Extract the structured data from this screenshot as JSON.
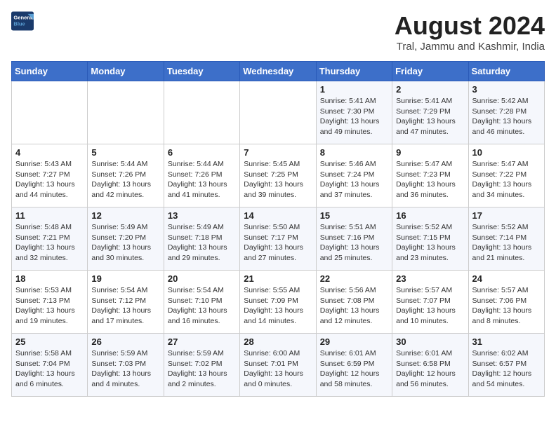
{
  "header": {
    "logo_line1": "General",
    "logo_line2": "Blue",
    "title": "August 2024",
    "subtitle": "Tral, Jammu and Kashmir, India"
  },
  "weekdays": [
    "Sunday",
    "Monday",
    "Tuesday",
    "Wednesday",
    "Thursday",
    "Friday",
    "Saturday"
  ],
  "weeks": [
    [
      {
        "day": "",
        "info": ""
      },
      {
        "day": "",
        "info": ""
      },
      {
        "day": "",
        "info": ""
      },
      {
        "day": "",
        "info": ""
      },
      {
        "day": "1",
        "info": "Sunrise: 5:41 AM\nSunset: 7:30 PM\nDaylight: 13 hours\nand 49 minutes."
      },
      {
        "day": "2",
        "info": "Sunrise: 5:41 AM\nSunset: 7:29 PM\nDaylight: 13 hours\nand 47 minutes."
      },
      {
        "day": "3",
        "info": "Sunrise: 5:42 AM\nSunset: 7:28 PM\nDaylight: 13 hours\nand 46 minutes."
      }
    ],
    [
      {
        "day": "4",
        "info": "Sunrise: 5:43 AM\nSunset: 7:27 PM\nDaylight: 13 hours\nand 44 minutes."
      },
      {
        "day": "5",
        "info": "Sunrise: 5:44 AM\nSunset: 7:26 PM\nDaylight: 13 hours\nand 42 minutes."
      },
      {
        "day": "6",
        "info": "Sunrise: 5:44 AM\nSunset: 7:26 PM\nDaylight: 13 hours\nand 41 minutes."
      },
      {
        "day": "7",
        "info": "Sunrise: 5:45 AM\nSunset: 7:25 PM\nDaylight: 13 hours\nand 39 minutes."
      },
      {
        "day": "8",
        "info": "Sunrise: 5:46 AM\nSunset: 7:24 PM\nDaylight: 13 hours\nand 37 minutes."
      },
      {
        "day": "9",
        "info": "Sunrise: 5:47 AM\nSunset: 7:23 PM\nDaylight: 13 hours\nand 36 minutes."
      },
      {
        "day": "10",
        "info": "Sunrise: 5:47 AM\nSunset: 7:22 PM\nDaylight: 13 hours\nand 34 minutes."
      }
    ],
    [
      {
        "day": "11",
        "info": "Sunrise: 5:48 AM\nSunset: 7:21 PM\nDaylight: 13 hours\nand 32 minutes."
      },
      {
        "day": "12",
        "info": "Sunrise: 5:49 AM\nSunset: 7:20 PM\nDaylight: 13 hours\nand 30 minutes."
      },
      {
        "day": "13",
        "info": "Sunrise: 5:49 AM\nSunset: 7:18 PM\nDaylight: 13 hours\nand 29 minutes."
      },
      {
        "day": "14",
        "info": "Sunrise: 5:50 AM\nSunset: 7:17 PM\nDaylight: 13 hours\nand 27 minutes."
      },
      {
        "day": "15",
        "info": "Sunrise: 5:51 AM\nSunset: 7:16 PM\nDaylight: 13 hours\nand 25 minutes."
      },
      {
        "day": "16",
        "info": "Sunrise: 5:52 AM\nSunset: 7:15 PM\nDaylight: 13 hours\nand 23 minutes."
      },
      {
        "day": "17",
        "info": "Sunrise: 5:52 AM\nSunset: 7:14 PM\nDaylight: 13 hours\nand 21 minutes."
      }
    ],
    [
      {
        "day": "18",
        "info": "Sunrise: 5:53 AM\nSunset: 7:13 PM\nDaylight: 13 hours\nand 19 minutes."
      },
      {
        "day": "19",
        "info": "Sunrise: 5:54 AM\nSunset: 7:12 PM\nDaylight: 13 hours\nand 17 minutes."
      },
      {
        "day": "20",
        "info": "Sunrise: 5:54 AM\nSunset: 7:10 PM\nDaylight: 13 hours\nand 16 minutes."
      },
      {
        "day": "21",
        "info": "Sunrise: 5:55 AM\nSunset: 7:09 PM\nDaylight: 13 hours\nand 14 minutes."
      },
      {
        "day": "22",
        "info": "Sunrise: 5:56 AM\nSunset: 7:08 PM\nDaylight: 13 hours\nand 12 minutes."
      },
      {
        "day": "23",
        "info": "Sunrise: 5:57 AM\nSunset: 7:07 PM\nDaylight: 13 hours\nand 10 minutes."
      },
      {
        "day": "24",
        "info": "Sunrise: 5:57 AM\nSunset: 7:06 PM\nDaylight: 13 hours\nand 8 minutes."
      }
    ],
    [
      {
        "day": "25",
        "info": "Sunrise: 5:58 AM\nSunset: 7:04 PM\nDaylight: 13 hours\nand 6 minutes."
      },
      {
        "day": "26",
        "info": "Sunrise: 5:59 AM\nSunset: 7:03 PM\nDaylight: 13 hours\nand 4 minutes."
      },
      {
        "day": "27",
        "info": "Sunrise: 5:59 AM\nSunset: 7:02 PM\nDaylight: 13 hours\nand 2 minutes."
      },
      {
        "day": "28",
        "info": "Sunrise: 6:00 AM\nSunset: 7:01 PM\nDaylight: 13 hours\nand 0 minutes."
      },
      {
        "day": "29",
        "info": "Sunrise: 6:01 AM\nSunset: 6:59 PM\nDaylight: 12 hours\nand 58 minutes."
      },
      {
        "day": "30",
        "info": "Sunrise: 6:01 AM\nSunset: 6:58 PM\nDaylight: 12 hours\nand 56 minutes."
      },
      {
        "day": "31",
        "info": "Sunrise: 6:02 AM\nSunset: 6:57 PM\nDaylight: 12 hours\nand 54 minutes."
      }
    ]
  ]
}
